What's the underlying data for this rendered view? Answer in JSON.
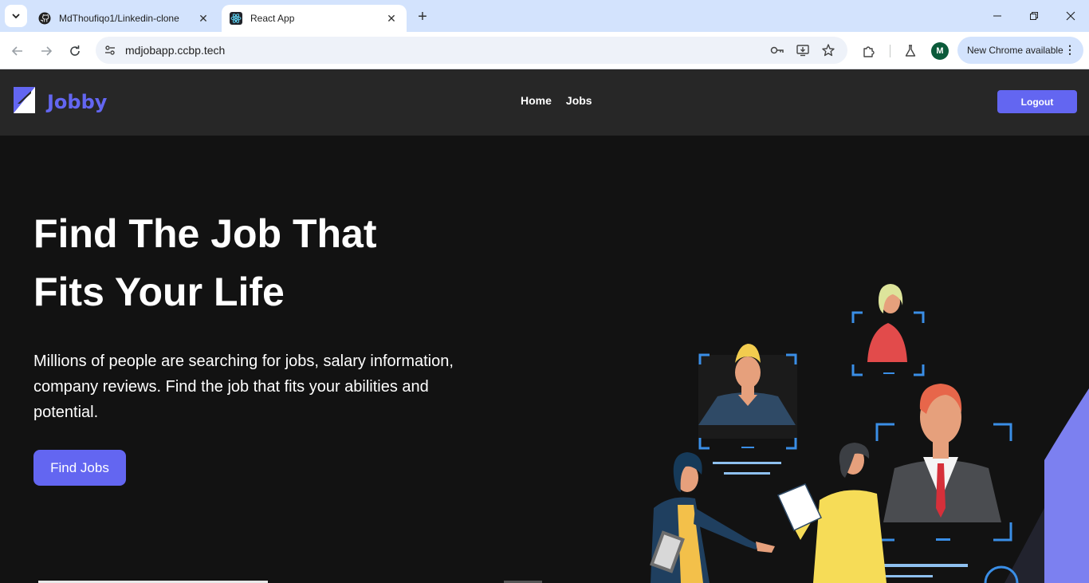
{
  "browser": {
    "tabs": [
      {
        "title": "MdThoufiqo1/Linkedin-clone",
        "active": false,
        "icon": "github-icon"
      },
      {
        "title": "React App",
        "active": true,
        "icon": "react-icon"
      }
    ],
    "url": "mdjobapp.ccbp.tech",
    "update_chip": "New Chrome available",
    "profile_initial": "M"
  },
  "header": {
    "brand": "Jobby",
    "nav": {
      "home": "Home",
      "jobs": "Jobs"
    },
    "logout_label": "Logout"
  },
  "hero": {
    "title_line1": "Find The Job That",
    "title_line2": "Fits Your Life",
    "description": "Millions of people are searching for jobs, salary information, company reviews. Find the job that fits your abilities and potential.",
    "cta_label": "Find Jobs"
  },
  "colors": {
    "accent": "#6366f1",
    "header_bg": "#272727",
    "page_bg": "#121212"
  }
}
